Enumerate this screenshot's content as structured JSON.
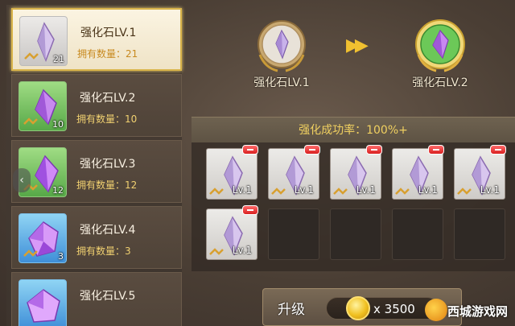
{
  "stone_list": [
    {
      "name": "强化石LV.1",
      "count_text": "拥有数量：21",
      "qty": "21",
      "grade": 1,
      "selected": true
    },
    {
      "name": "强化石LV.2",
      "count_text": "拥有数量：10",
      "qty": "10",
      "grade": 2,
      "selected": false
    },
    {
      "name": "强化石LV.3",
      "count_text": "拥有数量：12",
      "qty": "12",
      "grade": 3,
      "selected": false
    },
    {
      "name": "强化石LV.4",
      "count_text": "拥有数量：3",
      "qty": "3",
      "grade": 4,
      "selected": false
    },
    {
      "name": "强化石LV.5",
      "count_text": "",
      "qty": "",
      "grade": 5,
      "selected": false
    }
  ],
  "upgrade_preview": {
    "from_label": "强化石LV.1",
    "to_label": "强化石LV.2",
    "arrow_icon": "double-arrow-right-icon"
  },
  "success_rate_text": "强化成功率：100%+",
  "material_slots": [
    {
      "filled": true,
      "level": "Lv.1"
    },
    {
      "filled": true,
      "level": "Lv.1"
    },
    {
      "filled": true,
      "level": "Lv.1"
    },
    {
      "filled": true,
      "level": "Lv.1"
    },
    {
      "filled": true,
      "level": "Lv.1"
    },
    {
      "filled": true,
      "level": "Lv.1"
    },
    {
      "filled": false
    },
    {
      "filled": false
    },
    {
      "filled": false
    },
    {
      "filled": false
    }
  ],
  "upgrade_button": {
    "label": "升级",
    "cost": "x 3500"
  },
  "watermark": "西城游戏网",
  "colors": {
    "accent_gold": "#f0d060",
    "remove_red": "#d82020",
    "grade2_green": "#57a848",
    "grade4_blue": "#3f8fd8"
  }
}
